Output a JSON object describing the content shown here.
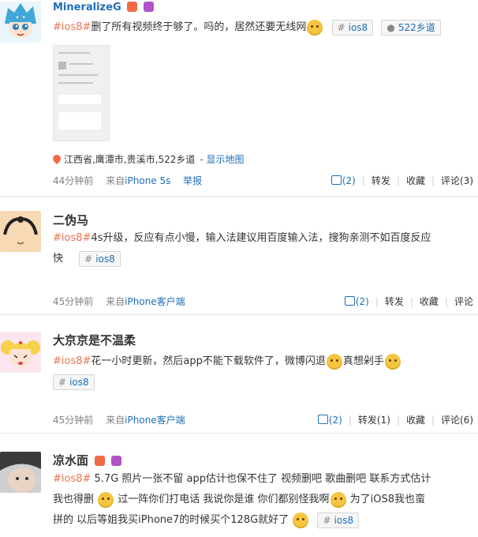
{
  "posts": [
    {
      "username": "MineralizeG",
      "topic": "#ios8#",
      "text": "删了所有视频终于够了。吗的，居然还要无线网",
      "tag": "ios8",
      "location_tag": "522乡道",
      "location_text": "江西省,鹰潭市,贵溪市,522乡道",
      "map_link": "- 显示地图",
      "time": "44分钟前",
      "source_prefix": "来自",
      "source": "iPhone 5s",
      "report": "举报",
      "likes": "(2)",
      "repost": "转发",
      "favorite": "收藏",
      "comment": "评论(3)"
    },
    {
      "username": "二伪马",
      "topic": "#ios8#",
      "text_line1": "4s升级，反应有点小慢，输入法建议用百度输入法，搜狗亲测不如百度反应",
      "text_line2": "快",
      "tag": "ios8",
      "time": "45分钟前",
      "source_prefix": "来自",
      "source": "iPhone客户端",
      "likes": "(2)",
      "repost": "转发",
      "favorite": "收藏",
      "comment": "评论"
    },
    {
      "username": "大京京是不温柔",
      "topic": "#ios8#",
      "text_a": "花一小时更新，然后app不能下载软件了，微博闪退",
      "text_b": "真想剁手",
      "tag": "ios8",
      "time": "45分钟前",
      "source_prefix": "来自",
      "source": "iPhone客户端",
      "likes": "(2)",
      "repost": "转发(1)",
      "favorite": "收藏",
      "comment": "评论(6)"
    },
    {
      "username": "凉水面",
      "topic": "#ios8#",
      "line1": " 5.7G 照片一张不留  app估计也保不住了  视频删吧  歌曲删吧  联系方式估计",
      "line2a": "我也得删 ",
      "line2b": "  过一阵你们打电话  我说你是谁  你们都别怪我啊",
      "line2c": "  为了iOS8我也蛮",
      "line3a": "拼的  以后等姐我买iPhone7的时候买个128G就好了 ",
      "tag": "ios8"
    }
  ],
  "colors": {
    "link": "#1e6fb5",
    "topic": "#eb7350",
    "meta": "#808080",
    "separator": "#e3e3e3"
  }
}
